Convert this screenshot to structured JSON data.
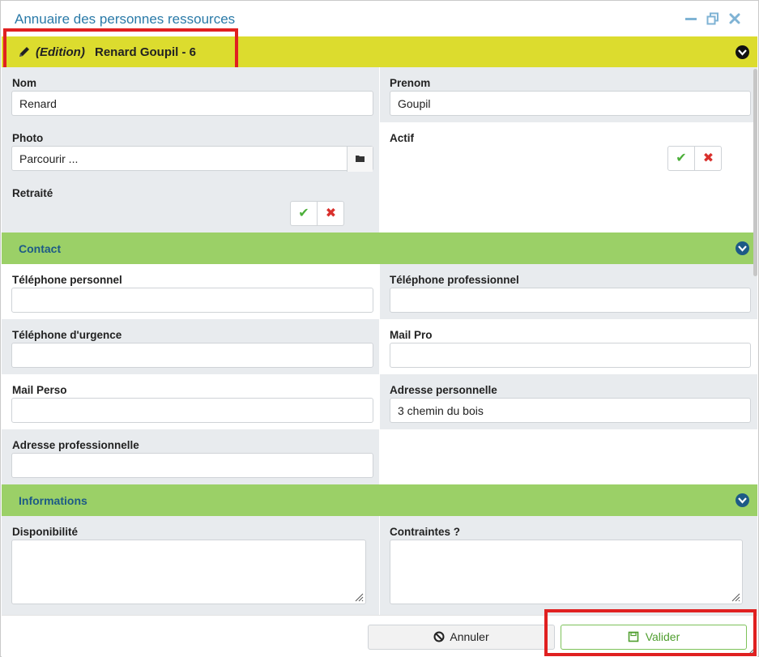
{
  "window": {
    "title": "Annuaire des personnes ressources",
    "controls": {
      "minimize": "minimize-icon",
      "restore": "restore-icon",
      "close": "close-icon"
    }
  },
  "edit_bar": {
    "mode": "(Edition)",
    "record_name": "Renard Goupil - 6",
    "color": "#dcdc2e"
  },
  "fields": {
    "nom": {
      "label": "Nom",
      "value": "Renard"
    },
    "prenom": {
      "label": "Prenom",
      "value": "Goupil"
    },
    "photo": {
      "label": "Photo",
      "value": "Parcourir ...",
      "browse_icon": "folder-icon"
    },
    "actif": {
      "label": "Actif"
    },
    "retraite": {
      "label": "Retraité"
    }
  },
  "sections": {
    "contact": {
      "title": "Contact",
      "color": "#9bd067"
    },
    "informations": {
      "title": "Informations",
      "color": "#9bd067"
    }
  },
  "contact": {
    "tel_perso": {
      "label": "Téléphone personnel",
      "value": ""
    },
    "tel_pro": {
      "label": "Téléphone professionnel",
      "value": ""
    },
    "tel_urgence": {
      "label": "Téléphone d'urgence",
      "value": ""
    },
    "mail_pro": {
      "label": "Mail Pro",
      "value": ""
    },
    "mail_perso": {
      "label": "Mail Perso",
      "value": ""
    },
    "adresse_perso": {
      "label": "Adresse personnelle",
      "value": "3  chemin du bois"
    },
    "adresse_pro": {
      "label": "Adresse professionnelle",
      "value": ""
    }
  },
  "informations": {
    "disponibilite": {
      "label": "Disponibilité",
      "value": ""
    },
    "contraintes": {
      "label": "Contraintes ?",
      "value": ""
    }
  },
  "footer": {
    "cancel_label": "Annuler",
    "submit_label": "Valider"
  },
  "colors": {
    "accent": "#2a7aa8",
    "highlight": "#e02020",
    "ok": "#4caf3a",
    "no": "#d9302c"
  }
}
